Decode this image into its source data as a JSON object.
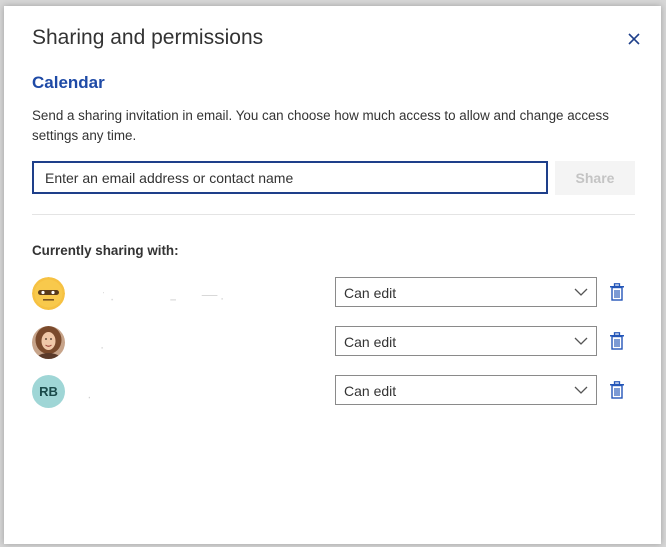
{
  "dialog": {
    "title": "Sharing and permissions",
    "close_icon": "close-icon"
  },
  "section": {
    "title": "Calendar",
    "description": "Send a sharing invitation in email. You can choose how much access to allow and change access settings any time."
  },
  "invite": {
    "placeholder": "Enter an email address or contact name",
    "value": "",
    "share_label": "Share"
  },
  "sharing": {
    "label": "Currently sharing with:",
    "people": [
      {
        "avatar": "emoji-avatar",
        "permission": "Can edit"
      },
      {
        "avatar": "photo-avatar",
        "permission": "Can edit"
      },
      {
        "avatar": "initials-avatar",
        "initials": "RB",
        "permission": "Can edit"
      }
    ]
  },
  "colors": {
    "accent": "#1e4aa6",
    "input_border": "#1e3f8a",
    "delete_icon": "#2456b8",
    "initials_bg": "#9fd6d6"
  }
}
